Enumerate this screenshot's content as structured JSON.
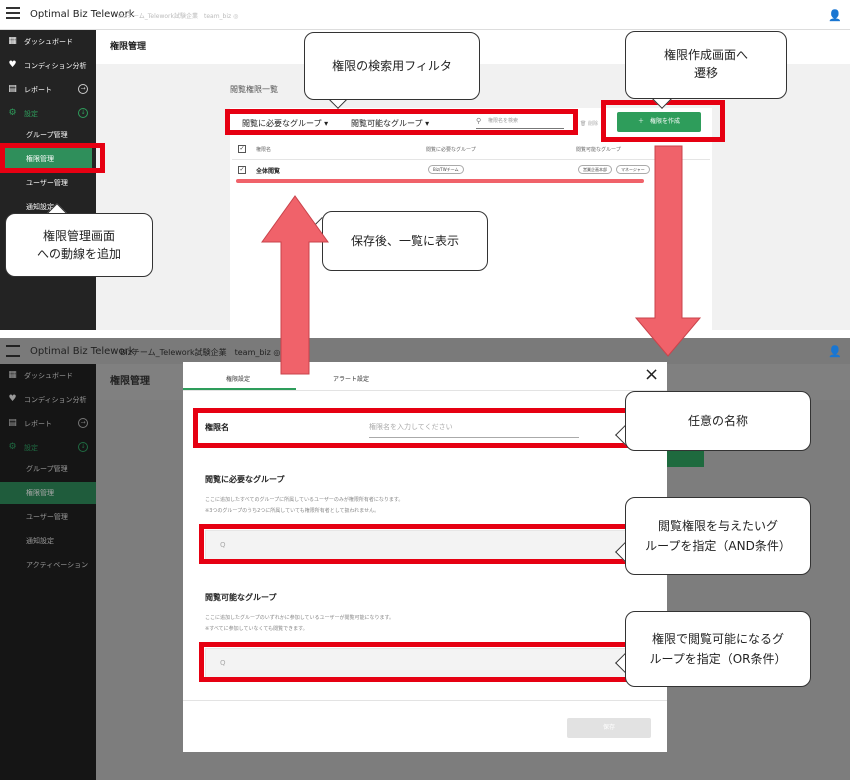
{
  "app": {
    "title": "Optimal Biz Telework",
    "sub_top": "Bizチーム_Telework試験企業　team_biz ◎",
    "sub_bottom": "Bizチーム_Telework試験企業　team_biz ◎"
  },
  "sidebar": {
    "items": [
      {
        "label": "ダッシュボード",
        "icon": "dashboard-icon"
      },
      {
        "label": "コンディション分析",
        "icon": "heart-icon"
      },
      {
        "label": "レポート",
        "icon": "report-icon"
      },
      {
        "label": "設定",
        "icon": "gear-icon"
      }
    ],
    "sub_items": [
      "グループ管理",
      "権限管理",
      "ユーザー管理",
      "通知設定",
      "アクティベーション"
    ]
  },
  "page": {
    "title": "権限管理",
    "list_title": "閲覧権限一覧",
    "filter_required": "閲覧に必要なグループ",
    "filter_viewable": "閲覧可能なグループ",
    "search_placeholder": "権限名を検索",
    "delete_label": "削除",
    "create_button": "権限を作成",
    "columns": [
      "権限名",
      "閲覧に必要なグループ",
      "閲覧可能なグループ"
    ],
    "rows": [
      {
        "name": "全体閲覧",
        "required": "Biz/TWチーム",
        "viewable": [
          "営業企画本部",
          "マネージャー"
        ]
      }
    ]
  },
  "modal": {
    "tabs": [
      "権限設定",
      "アラート設定"
    ],
    "name_label": "権限名",
    "name_placeholder": "権限名を入力してください",
    "required_title": "閲覧に必要なグループ",
    "required_desc1": "ここに追加したすべてのグループに所属しているユーザーのみが権限所有者になります。",
    "required_desc2": "※3つのグループのうち2つに所属していても権限所有者として扱われません。",
    "viewable_title": "閲覧可能なグループ",
    "viewable_desc1": "ここに追加したグループのいずれかに参加しているユーザーが閲覧可能になります。",
    "viewable_desc2": "※すべてに参加していなくても閲覧できます。",
    "search_placeholder": "Q",
    "save_button": "保存",
    "close_symbol": "×"
  },
  "annotations": {
    "filter": "権限の検索用フィルタ",
    "create_line1": "権限作成画面へ",
    "create_line2": "遷移",
    "nav_line1": "権限管理画面",
    "nav_line2": "への動線を追加",
    "saved": "保存後、一覧に表示",
    "name": "任意の名称",
    "and_line1": "閲覧権限を与えたいグ",
    "and_line2": "ループを指定（AND条件）",
    "or_line1": "権限で閲覧可能になるグ",
    "or_line2": "ループを指定（OR条件）"
  },
  "colors": {
    "accent": "#2e9d5b",
    "annotation_red": "#e60012",
    "arrow_red": "#f0626a"
  }
}
